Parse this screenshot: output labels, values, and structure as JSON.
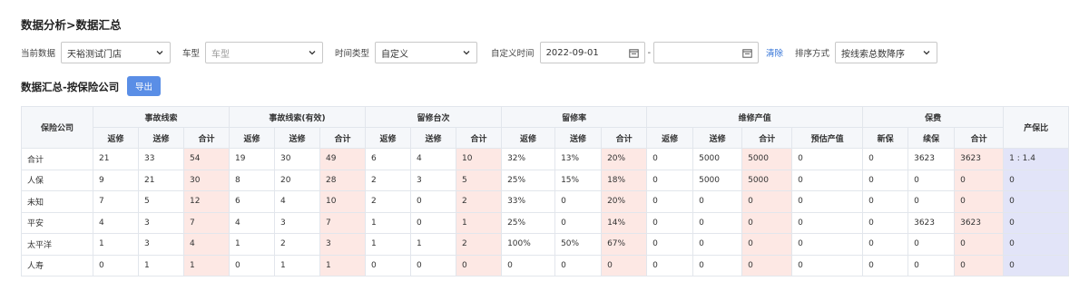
{
  "page": {
    "title": "数据分析>数据汇总",
    "subtitle": "数据汇总-按保险公司",
    "export_label": "导出"
  },
  "filters": {
    "current_data_label": "当前数据",
    "current_data_value": "天裕测试门店",
    "car_model_label": "车型",
    "car_model_placeholder": "车型",
    "time_type_label": "时间类型",
    "time_type_value": "自定义",
    "custom_time_label": "自定义时间",
    "start_date": "2022-09-01",
    "range_sep": "-",
    "end_date": "",
    "clear_label": "清除",
    "sort_label": "排序方式",
    "sort_value": "按线索总数降序"
  },
  "table": {
    "header_top": [
      "保险公司",
      "事故线索",
      "事故线索(有效)",
      "留修台次",
      "留修率",
      "维修产值",
      "保费",
      "产保比"
    ],
    "header_sub": [
      "返修",
      "送修",
      "合计",
      "返修",
      "送修",
      "合计",
      "返修",
      "送修",
      "合计",
      "返修",
      "送修",
      "合计",
      "返修",
      "送修",
      "合计",
      "预估产值",
      "新保",
      "续保",
      "合计"
    ],
    "rows": [
      [
        "合计",
        "21",
        "33",
        "54",
        "19",
        "30",
        "49",
        "6",
        "4",
        "10",
        "32%",
        "13%",
        "20%",
        "0",
        "5000",
        "5000",
        "0",
        "0",
        "3623",
        "3623",
        "1 : 1.4"
      ],
      [
        "人保",
        "9",
        "21",
        "30",
        "8",
        "20",
        "28",
        "2",
        "3",
        "5",
        "25%",
        "15%",
        "18%",
        "0",
        "5000",
        "5000",
        "0",
        "0",
        "0",
        "0",
        "0"
      ],
      [
        "未知",
        "7",
        "5",
        "12",
        "6",
        "4",
        "10",
        "2",
        "0",
        "2",
        "33%",
        "0",
        "20%",
        "0",
        "0",
        "0",
        "0",
        "0",
        "0",
        "0",
        "0"
      ],
      [
        "平安",
        "4",
        "3",
        "7",
        "4",
        "3",
        "7",
        "1",
        "0",
        "1",
        "25%",
        "0",
        "14%",
        "0",
        "0",
        "0",
        "0",
        "0",
        "3623",
        "3623",
        "0"
      ],
      [
        "太平洋",
        "1",
        "3",
        "4",
        "1",
        "2",
        "3",
        "1",
        "1",
        "2",
        "100%",
        "50%",
        "67%",
        "0",
        "0",
        "0",
        "0",
        "0",
        "0",
        "0",
        "0"
      ],
      [
        "人寿",
        "0",
        "1",
        "1",
        "0",
        "1",
        "1",
        "0",
        "0",
        "0",
        "0",
        "0",
        "0",
        "0",
        "0",
        "0",
        "0",
        "0",
        "0",
        "0",
        "0"
      ]
    ]
  }
}
